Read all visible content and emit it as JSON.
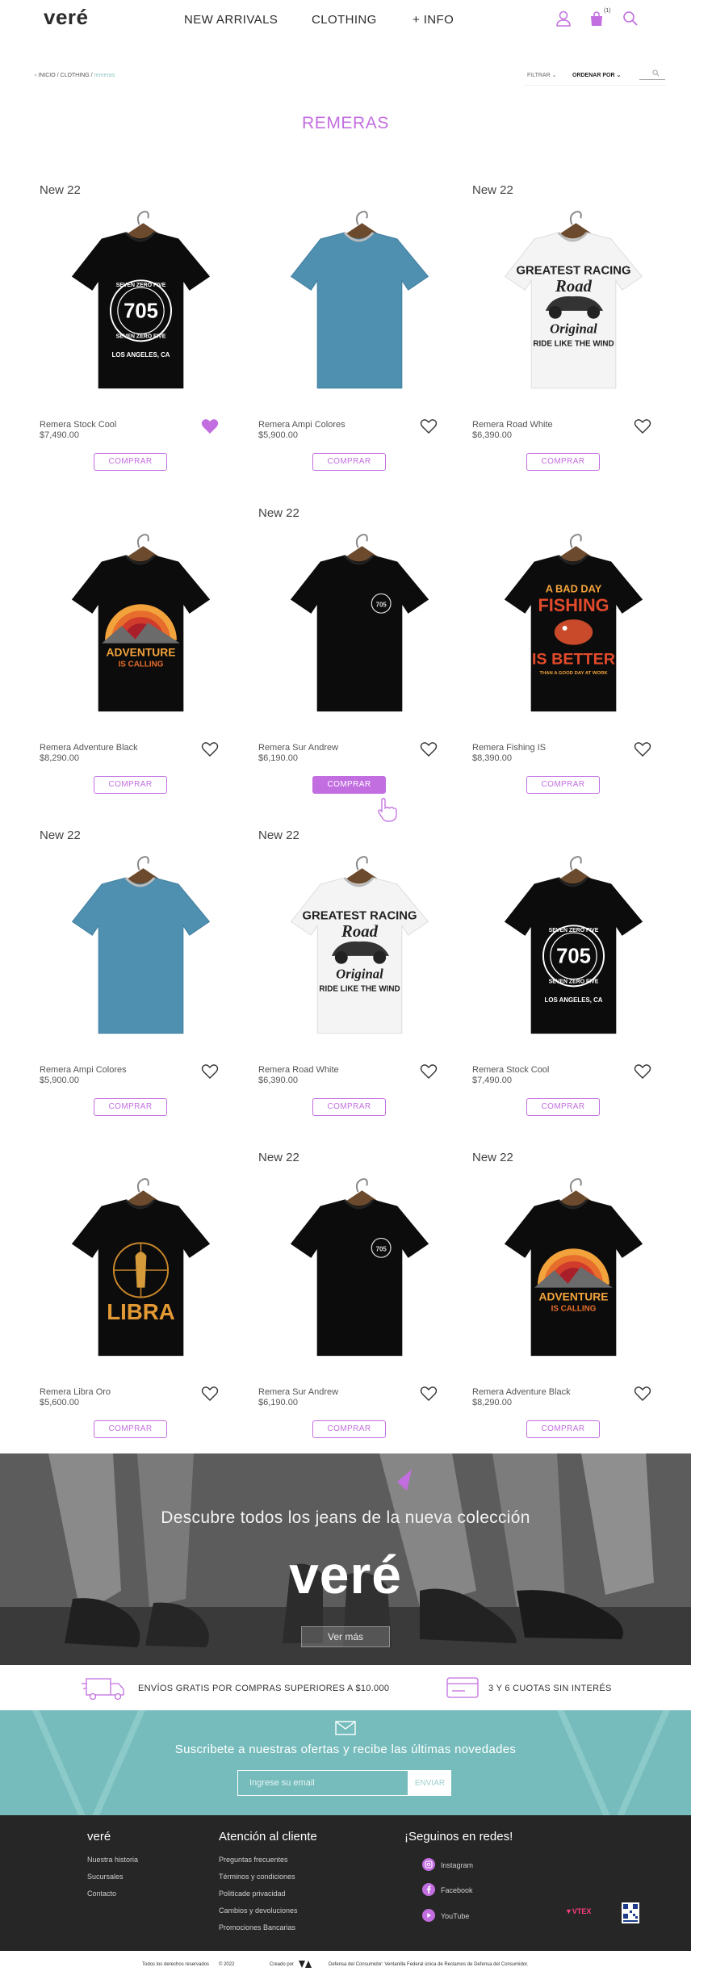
{
  "header": {
    "logo": "veré",
    "nav": [
      "NEW ARRIVALS",
      "CLOTHING",
      "+ INFO"
    ],
    "cart_count": "(1)"
  },
  "breadcrumb": {
    "items": [
      "INICIO",
      "CLOTHING"
    ],
    "current": "remeras"
  },
  "toolbar": {
    "filter_label": "FILTRAR",
    "order_label": "ORDENAR POR"
  },
  "page_title": "REMERAS",
  "products": [
    {
      "badge": "New 22",
      "name": "Remera Stock Cool",
      "price": "$7,490.00",
      "buy": "COMPRAR",
      "favorite": true,
      "shirt": "black-705"
    },
    {
      "badge": "",
      "name": "Remera Ampi Colores",
      "price": "$5,900.00",
      "buy": "COMPRAR",
      "favorite": false,
      "shirt": "blue"
    },
    {
      "badge": "New 22",
      "name": "Remera Road White",
      "price": "$6,390.00",
      "buy": "COMPRAR",
      "favorite": false,
      "shirt": "white-road"
    },
    {
      "badge": "",
      "name": "Remera Adventure Black",
      "price": "$8,290.00",
      "buy": "COMPRAR",
      "favorite": false,
      "shirt": "black-adventure"
    },
    {
      "badge": "New 22",
      "name": "Remera Sur Andrew",
      "price": "$6,190.00",
      "buy": "COMPRAR",
      "favorite": false,
      "shirt": "black-small"
    },
    {
      "badge": "",
      "name": "Remera Fishing IS",
      "price": "$8,390.00",
      "buy": "COMPRAR",
      "favorite": false,
      "shirt": "black-fishing"
    },
    {
      "badge": "New 22",
      "name": "Remera Ampi Colores",
      "price": "$5,900.00",
      "buy": "COMPRAR",
      "favorite": false,
      "shirt": "blue"
    },
    {
      "badge": "New 22",
      "name": "Remera Road White",
      "price": "$6,390.00",
      "buy": "COMPRAR",
      "favorite": false,
      "shirt": "white-road"
    },
    {
      "badge": "",
      "name": "Remera Stock Cool",
      "price": "$7,490.00",
      "buy": "COMPRAR",
      "favorite": false,
      "shirt": "black-705"
    },
    {
      "badge": "",
      "name": "Remera Libra Oro",
      "price": "$5,600.00",
      "buy": "COMPRAR",
      "favorite": false,
      "shirt": "black-libra"
    },
    {
      "badge": "New 22",
      "name": "Remera Sur Andrew",
      "price": "$6,190.00",
      "buy": "COMPRAR",
      "favorite": false,
      "shirt": "black-small"
    },
    {
      "badge": "New 22",
      "name": "Remera Adventure Black",
      "price": "$8,290.00",
      "buy": "COMPRAR",
      "favorite": false,
      "shirt": "black-adventure"
    }
  ],
  "shirt_prints": {
    "705_top": "SEVEN ZERO FIVE",
    "705_num": "705",
    "705_bottom": "SEVEN ZERO FIVE",
    "705_city": "LOS ANGELES, CA",
    "road_1": "GREATEST RACING",
    "road_2": "Road",
    "road_3": "Original",
    "road_4": "RIDE LIKE THE WIND",
    "adv_1": "ADVENTURE",
    "adv_2": "IS CALLING",
    "fish_1": "A BAD DAY",
    "fish_2": "FISHING",
    "fish_3": "IS BETTER",
    "fish_4": "THAN A GOOD DAY AT WORK",
    "libra": "LIBRA"
  },
  "banner": {
    "title": "Descubre todos los jeans de la nueva colección",
    "logo": "veré",
    "button": "Ver más"
  },
  "shipping": {
    "free": "ENVÍOS GRATIS POR COMPRAS SUPERIORES A $10.000",
    "installments": "3 Y 6 CUOTAS SIN INTERÉS"
  },
  "newsletter": {
    "text": "Suscribete a nuestras ofertas y recibe las últimas novedades",
    "placeholder": "Ingrese su email",
    "button": "ENVIAR"
  },
  "footer": {
    "col1_title": "veré",
    "col1_links": [
      "Nuestra historia",
      "Sucursales",
      "Contacto"
    ],
    "col2_title": "Atención al cliente",
    "col2_links": [
      "Preguntas frecuentes",
      "Términos y condiciones",
      "Politicade privacidad",
      "Cambios y devoluciones",
      "Promociones Bancarias"
    ],
    "col3_title": "¡Seguinos en redes!",
    "social": [
      "Instagram",
      "Facebook",
      "YouTube"
    ],
    "vtex": "VTEX"
  },
  "bottom": {
    "rights": "Todos los derechos reservados",
    "year": "© 2022",
    "created": "Creado por",
    "consumer": "Defensa del Consumidor: Ventanilla Federal única de Reclamos de Defensa del Consumidor."
  },
  "colors": {
    "accent": "#c36ee0",
    "teal": "#76bcbc",
    "footer": "#262626"
  }
}
